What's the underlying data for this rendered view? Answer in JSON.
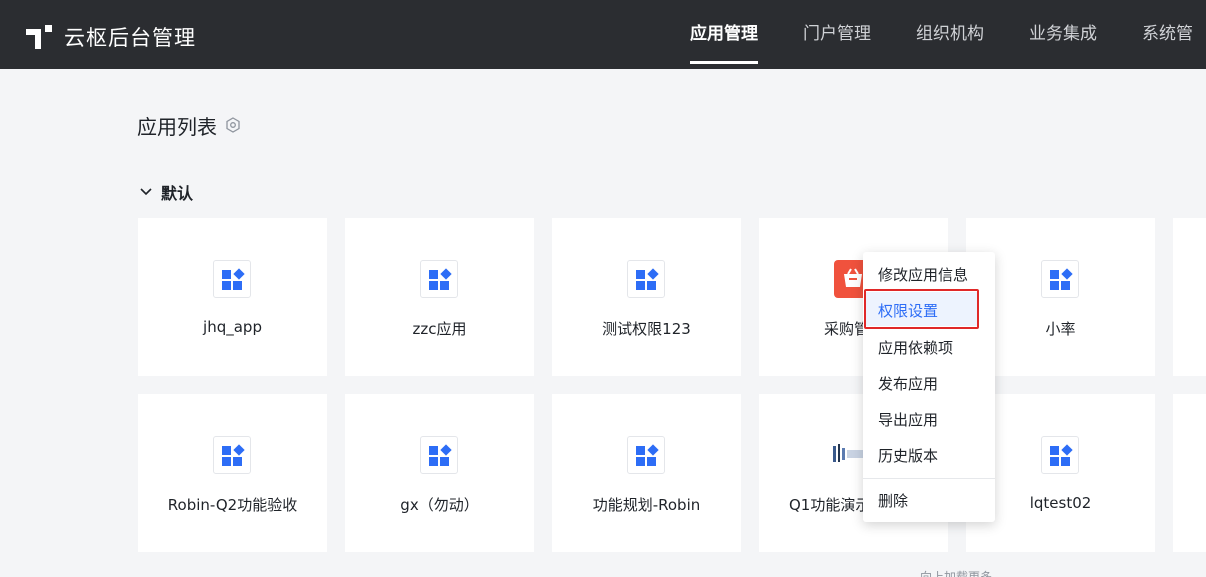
{
  "app": {
    "title": "云枢后台管理"
  },
  "nav": {
    "items": [
      {
        "label": "应用管理",
        "active": true
      },
      {
        "label": "门户管理"
      },
      {
        "label": "组织机构"
      },
      {
        "label": "业务集成"
      },
      {
        "label": "系统管"
      }
    ]
  },
  "page": {
    "title": "应用列表",
    "title_icon": "gear-icon"
  },
  "group": {
    "label": "默认",
    "icon": "chevron-down-icon"
  },
  "apps": [
    {
      "name": "jhq_app",
      "icon": "app-grid-icon"
    },
    {
      "name": "zzc应用",
      "icon": "app-grid-icon"
    },
    {
      "name": "测试权限123",
      "icon": "app-grid-icon"
    },
    {
      "name": "采购管",
      "icon": "shopping-cart-icon"
    },
    {
      "name": "小率",
      "icon": "app-grid-icon"
    },
    {
      "name": "Robin-Q2功能验收",
      "icon": "app-grid-icon"
    },
    {
      "name": "gx（勿动）",
      "icon": "app-grid-icon"
    },
    {
      "name": "功能规划-Robin",
      "icon": "app-grid-icon"
    },
    {
      "name": "Q1功能演示",
      "icon": "image-logo-icon"
    },
    {
      "name": "lqtest02",
      "icon": "app-grid-icon"
    }
  ],
  "context_menu": {
    "items": [
      {
        "label": "修改应用信息"
      },
      {
        "label": "权限设置",
        "highlighted": true
      },
      {
        "label": "应用依赖项"
      },
      {
        "label": "发布应用"
      },
      {
        "label": "导出应用"
      },
      {
        "label": "历史版本"
      },
      {
        "label": "删除"
      }
    ]
  },
  "footer": {
    "load_more": "向上加载更多"
  },
  "colors": {
    "accent": "#2d6df6",
    "topbar": "#2b2d31",
    "highlight_box": "#e02828"
  }
}
